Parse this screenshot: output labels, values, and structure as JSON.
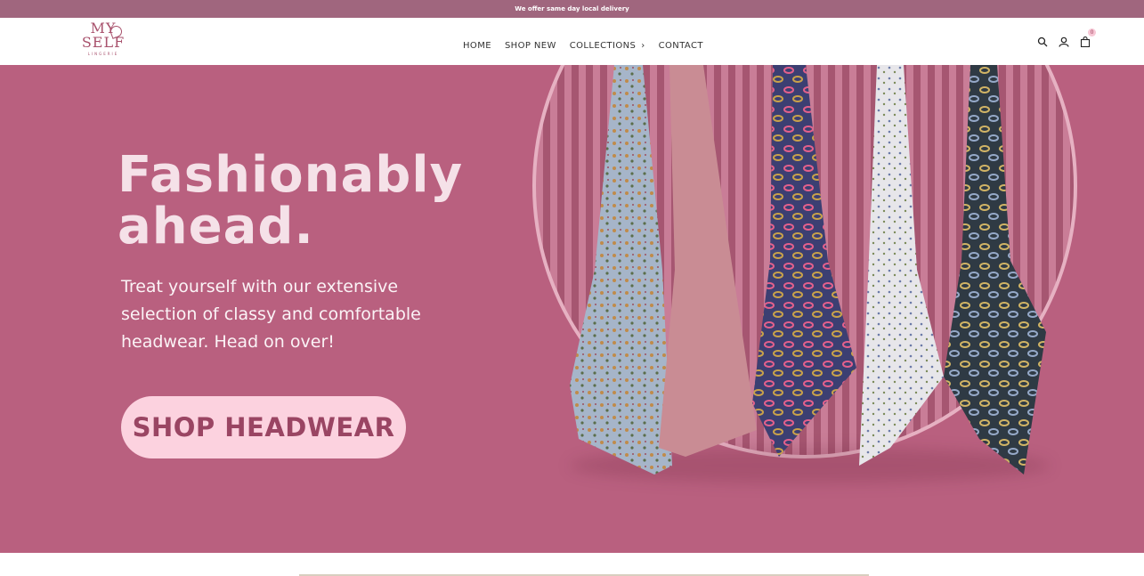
{
  "announcement": "We offer same day local delivery",
  "brand": {
    "line1": "MY",
    "line2": "SELF",
    "sub": "LINGERIE",
    "color": "#a8516c"
  },
  "nav": {
    "items": [
      {
        "label": "HOME"
      },
      {
        "label": "SHOP NEW"
      },
      {
        "label": "COLLECTIONS"
      },
      {
        "label": "CONTACT"
      }
    ]
  },
  "header_icons": [
    "search-icon",
    "account-icon",
    "cart-icon"
  ],
  "cart_count": "0",
  "hero": {
    "title_line1": "Fashionably",
    "title_line2": "ahead.",
    "text": "Treat yourself with our extensive selection of classy and comfortable headwear. Head on over!",
    "button": "SHOP HEADWEAR",
    "background": "#b9607f",
    "button_color": "#fcd2df"
  }
}
